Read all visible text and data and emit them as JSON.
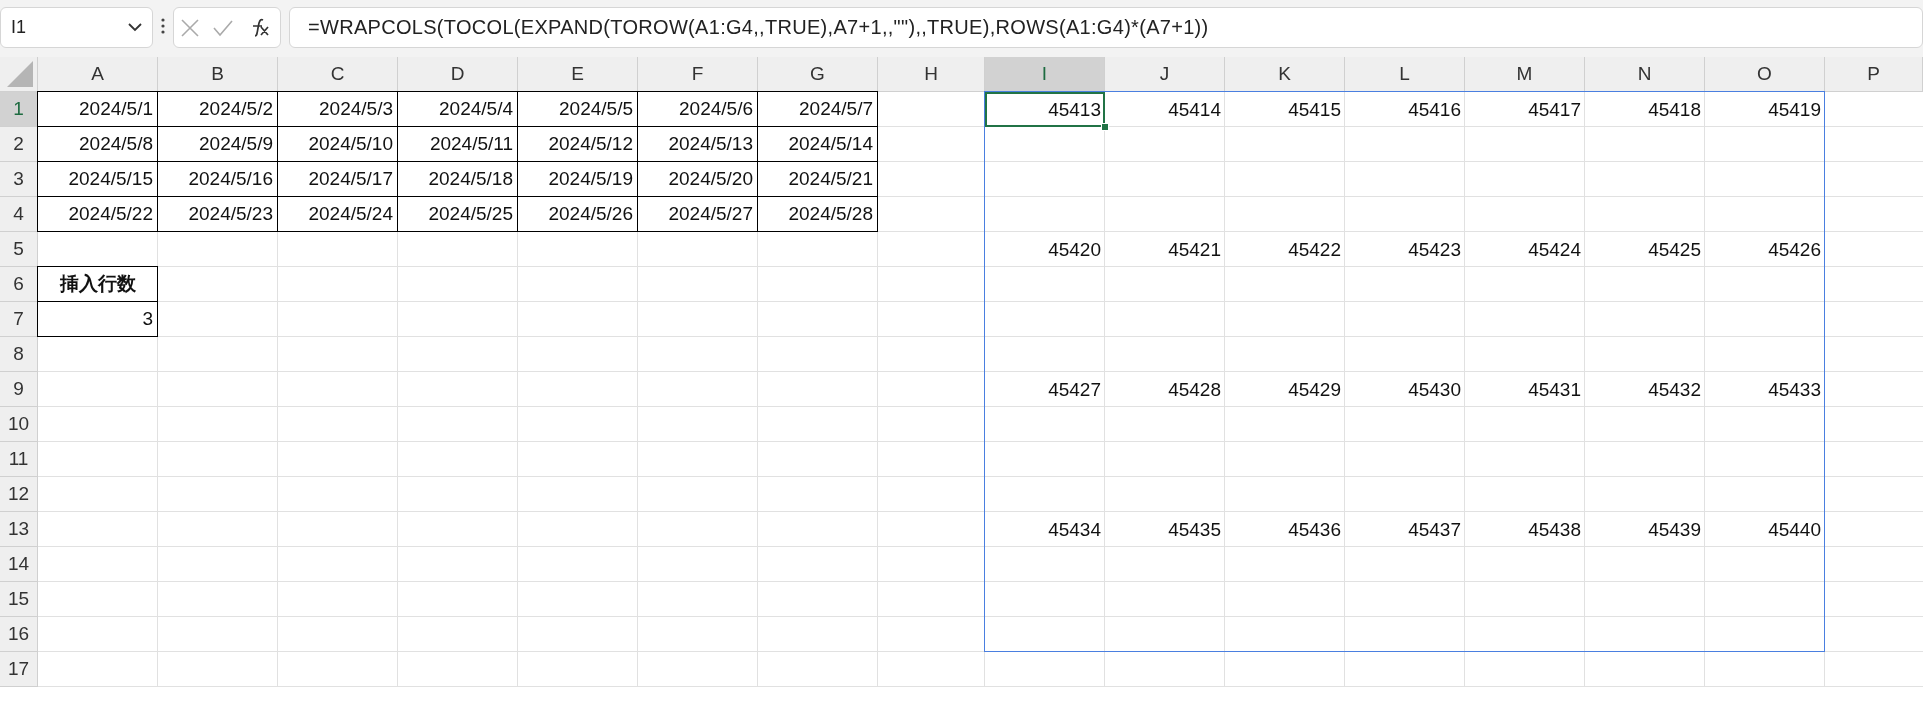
{
  "formula_bar": {
    "name_box": "I1",
    "formula": "=WRAPCOLS(TOCOL(EXPAND(TOROW(A1:G4,,TRUE),A7+1,,\"\"),,TRUE),ROWS(A1:G4)*(A7+1))"
  },
  "columns": [
    {
      "label": "A",
      "selected": false
    },
    {
      "label": "B",
      "selected": false
    },
    {
      "label": "C",
      "selected": false
    },
    {
      "label": "D",
      "selected": false
    },
    {
      "label": "E",
      "selected": false
    },
    {
      "label": "F",
      "selected": false
    },
    {
      "label": "G",
      "selected": false
    },
    {
      "label": "H",
      "selected": false
    },
    {
      "label": "I",
      "selected": true
    },
    {
      "label": "J",
      "selected": false
    },
    {
      "label": "K",
      "selected": false
    },
    {
      "label": "L",
      "selected": false
    },
    {
      "label": "M",
      "selected": false
    },
    {
      "label": "N",
      "selected": false
    },
    {
      "label": "O",
      "selected": false
    },
    {
      "label": "P",
      "selected": false
    }
  ],
  "rows": [
    {
      "label": "1",
      "selected": true,
      "cells": [
        {
          "text": "2024/5/1",
          "bordered": true
        },
        {
          "text": "2024/5/2",
          "bordered": true
        },
        {
          "text": "2024/5/3",
          "bordered": true
        },
        {
          "text": "2024/5/4",
          "bordered": true
        },
        {
          "text": "2024/5/5",
          "bordered": true
        },
        {
          "text": "2024/5/6",
          "bordered": true
        },
        {
          "text": "2024/5/7",
          "bordered": true
        },
        null,
        {
          "text": "45413",
          "selected": true,
          "spill": true
        },
        {
          "text": "45414",
          "selected": false
        },
        {
          "text": "45415",
          "selected": false
        },
        {
          "text": "45416",
          "selected": false
        },
        {
          "text": "45417",
          "selected": false
        },
        {
          "text": "45418",
          "selected": false
        },
        {
          "text": "45419",
          "selected": false
        },
        null
      ]
    },
    {
      "label": "2",
      "selected": false,
      "cells": [
        {
          "text": "2024/5/8",
          "bordered": true
        },
        {
          "text": "2024/5/9",
          "bordered": true
        },
        {
          "text": "2024/5/10",
          "bordered": true
        },
        {
          "text": "2024/5/11",
          "bordered": true
        },
        {
          "text": "2024/5/12",
          "bordered": true
        },
        {
          "text": "2024/5/13",
          "bordered": true
        },
        {
          "text": "2024/5/14",
          "bordered": true
        },
        null,
        null,
        null,
        null,
        null,
        null,
        null,
        null,
        null
      ]
    },
    {
      "label": "3",
      "selected": false,
      "cells": [
        {
          "text": "2024/5/15",
          "bordered": true
        },
        {
          "text": "2024/5/16",
          "bordered": true
        },
        {
          "text": "2024/5/17",
          "bordered": true
        },
        {
          "text": "2024/5/18",
          "bordered": true
        },
        {
          "text": "2024/5/19",
          "bordered": true
        },
        {
          "text": "2024/5/20",
          "bordered": true
        },
        {
          "text": "2024/5/21",
          "bordered": true
        },
        null,
        null,
        null,
        null,
        null,
        null,
        null,
        null,
        null
      ]
    },
    {
      "label": "4",
      "selected": false,
      "cells": [
        {
          "text": "2024/5/22",
          "bordered": true
        },
        {
          "text": "2024/5/23",
          "bordered": true
        },
        {
          "text": "2024/5/24",
          "bordered": true
        },
        {
          "text": "2024/5/25",
          "bordered": true
        },
        {
          "text": "2024/5/26",
          "bordered": true
        },
        {
          "text": "2024/5/27",
          "bordered": true
        },
        {
          "text": "2024/5/28",
          "bordered": true
        },
        null,
        null,
        null,
        null,
        null,
        null,
        null,
        null,
        null
      ]
    },
    {
      "label": "5",
      "selected": false,
      "cells": [
        null,
        null,
        null,
        null,
        null,
        null,
        null,
        null,
        {
          "text": "45420",
          "selected": false
        },
        {
          "text": "45421",
          "selected": false
        },
        {
          "text": "45422",
          "selected": false
        },
        {
          "text": "45423",
          "selected": false
        },
        {
          "text": "45424",
          "selected": false
        },
        {
          "text": "45425",
          "selected": false
        },
        {
          "text": "45426",
          "selected": false
        },
        null
      ]
    },
    {
      "label": "6",
      "selected": false,
      "cells": [
        {
          "text": "挿入行数",
          "bordered": true,
          "kind": "header"
        },
        null,
        null,
        null,
        null,
        null,
        null,
        null,
        null,
        null,
        null,
        null,
        null,
        null,
        null,
        null
      ]
    },
    {
      "label": "7",
      "selected": false,
      "cells": [
        {
          "text": "3",
          "bordered": true
        },
        null,
        null,
        null,
        null,
        null,
        null,
        null,
        null,
        null,
        null,
        null,
        null,
        null,
        null,
        null
      ]
    },
    {
      "label": "8",
      "selected": false,
      "cells": [
        null,
        null,
        null,
        null,
        null,
        null,
        null,
        null,
        null,
        null,
        null,
        null,
        null,
        null,
        null,
        null
      ]
    },
    {
      "label": "9",
      "selected": false,
      "cells": [
        null,
        null,
        null,
        null,
        null,
        null,
        null,
        null,
        {
          "text": "45427",
          "selected": false
        },
        {
          "text": "45428",
          "selected": false
        },
        {
          "text": "45429",
          "selected": false
        },
        {
          "text": "45430",
          "selected": false
        },
        {
          "text": "45431",
          "selected": false
        },
        {
          "text": "45432",
          "selected": false
        },
        {
          "text": "45433",
          "selected": false
        },
        null
      ]
    },
    {
      "label": "10",
      "selected": false,
      "cells": [
        null,
        null,
        null,
        null,
        null,
        null,
        null,
        null,
        null,
        null,
        null,
        null,
        null,
        null,
        null,
        null
      ]
    },
    {
      "label": "11",
      "selected": false,
      "cells": [
        null,
        null,
        null,
        null,
        null,
        null,
        null,
        null,
        null,
        null,
        null,
        null,
        null,
        null,
        null,
        null
      ]
    },
    {
      "label": "12",
      "selected": false,
      "cells": [
        null,
        null,
        null,
        null,
        null,
        null,
        null,
        null,
        null,
        null,
        null,
        null,
        null,
        null,
        null,
        null
      ]
    },
    {
      "label": "13",
      "selected": false,
      "cells": [
        null,
        null,
        null,
        null,
        null,
        null,
        null,
        null,
        {
          "text": "45434",
          "selected": false
        },
        {
          "text": "45435",
          "selected": false
        },
        {
          "text": "45436",
          "selected": false
        },
        {
          "text": "45437",
          "selected": false
        },
        {
          "text": "45438",
          "selected": false
        },
        {
          "text": "45439",
          "selected": false
        },
        {
          "text": "45440",
          "selected": false
        },
        null
      ]
    },
    {
      "label": "14",
      "selected": false,
      "cells": [
        null,
        null,
        null,
        null,
        null,
        null,
        null,
        null,
        null,
        null,
        null,
        null,
        null,
        null,
        null,
        null
      ]
    },
    {
      "label": "15",
      "selected": false,
      "cells": [
        null,
        null,
        null,
        null,
        null,
        null,
        null,
        null,
        null,
        null,
        null,
        null,
        null,
        null,
        null,
        null
      ]
    },
    {
      "label": "16",
      "selected": false,
      "cells": [
        null,
        null,
        null,
        null,
        null,
        null,
        null,
        null,
        null,
        null,
        null,
        null,
        null,
        null,
        null,
        null
      ]
    },
    {
      "label": "17",
      "selected": false,
      "cells": [
        null,
        null,
        null,
        null,
        null,
        null,
        null,
        null,
        null,
        null,
        null,
        null,
        null,
        null,
        null,
        null
      ]
    }
  ]
}
